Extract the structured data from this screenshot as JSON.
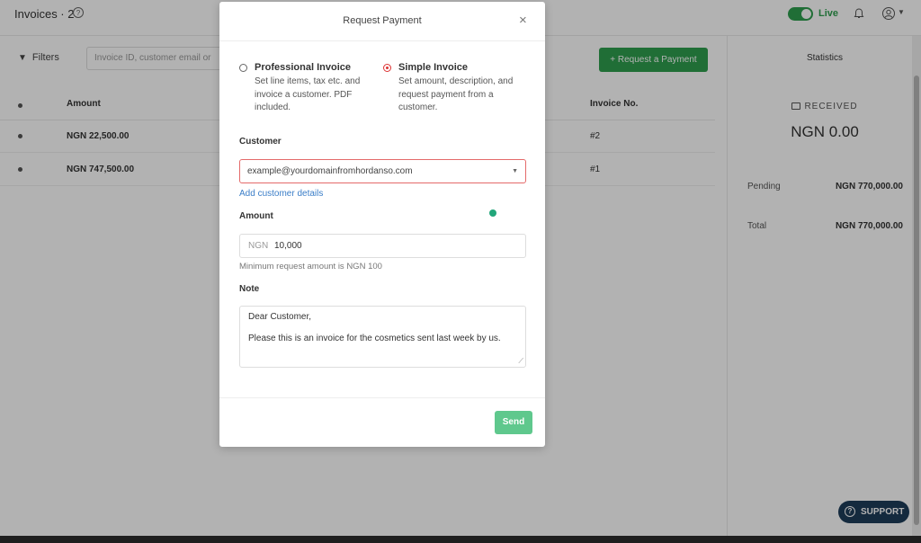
{
  "header": {
    "title": "Invoices · 2",
    "live_label": "Live",
    "help_icon": "question-circle-icon",
    "bell_icon": "bell-icon",
    "user_icon": "user-circle-icon"
  },
  "toolbar": {
    "filters_label": "Filters",
    "search_placeholder": "Invoice ID, customer email or",
    "request_button_label": "+ Request a Payment"
  },
  "table": {
    "columns": [
      "Amount",
      "Invoice No."
    ],
    "rows": [
      {
        "amount": "NGN 22,500.00",
        "invoice_no": "#2"
      },
      {
        "amount": "NGN 747,500.00",
        "invoice_no": "#1"
      }
    ]
  },
  "stats": {
    "title": "Statistics",
    "received_label": "RECEIVED",
    "received_value": "NGN 0.00",
    "pending_label": "Pending",
    "pending_value": "NGN 770,000.00",
    "total_label": "Total",
    "total_value": "NGN 770,000.00"
  },
  "support_label": "SUPPORT",
  "modal": {
    "title": "Request Payment",
    "options": [
      {
        "title": "Professional Invoice",
        "desc": "Set line items, tax etc. and invoice a customer. PDF included.",
        "selected": false
      },
      {
        "title": "Simple Invoice",
        "desc": "Set amount, description, and request payment from a customer.",
        "selected": true
      }
    ],
    "customer_label": "Customer",
    "customer_value": "example@yourdomainfromhordanso.com",
    "add_customer_link": "Add customer details",
    "amount_label": "Amount",
    "amount_currency": "NGN",
    "amount_value": "10,000",
    "amount_hint": "Minimum request amount is NGN 100",
    "note_label": "Note",
    "note_line1": "Dear Customer,",
    "note_line2": "Please this is an invoice for the cosmetics sent last week by us.",
    "send_label": "Send"
  },
  "colors": {
    "brand_green": "#2e9e4e",
    "send_green": "#5fc88d",
    "error_red": "#e46a6a",
    "link_blue": "#3b7ec8",
    "support_navy": "#1e3d5a"
  }
}
